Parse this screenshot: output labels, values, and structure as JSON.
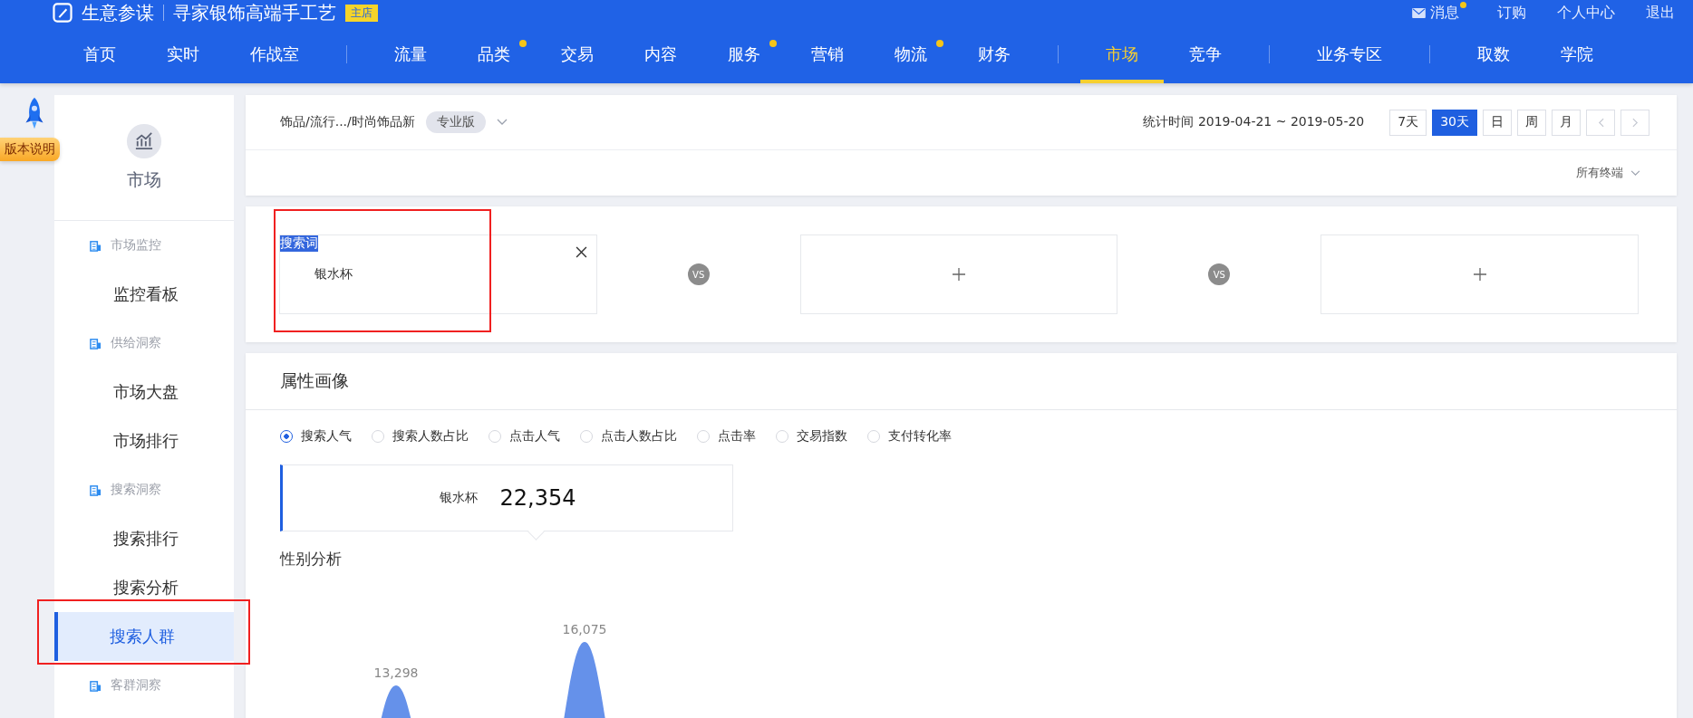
{
  "header": {
    "brand": "生意参谋",
    "shop": "寻家银饰高端手工艺",
    "shop_badge": "主店",
    "top_links": [
      {
        "label": "消息",
        "kind": "mail",
        "dot": true
      },
      {
        "label": "订购",
        "kind": "plain",
        "dot": false
      },
      {
        "label": "个人中心",
        "kind": "plain",
        "dot": false
      },
      {
        "label": "退出",
        "kind": "plain",
        "dot": false
      }
    ],
    "nav_groups": [
      [
        {
          "label": "首页",
          "dot": false,
          "selected": false
        },
        {
          "label": "实时",
          "dot": false,
          "selected": false
        },
        {
          "label": "作战室",
          "dot": false,
          "selected": false
        }
      ],
      [
        {
          "label": "流量",
          "dot": false,
          "selected": false
        },
        {
          "label": "品类",
          "dot": true,
          "selected": false
        },
        {
          "label": "交易",
          "dot": false,
          "selected": false
        },
        {
          "label": "内容",
          "dot": false,
          "selected": false
        },
        {
          "label": "服务",
          "dot": true,
          "selected": false
        },
        {
          "label": "营销",
          "dot": false,
          "selected": false
        },
        {
          "label": "物流",
          "dot": true,
          "selected": false
        },
        {
          "label": "财务",
          "dot": false,
          "selected": false
        }
      ],
      [
        {
          "label": "市场",
          "dot": false,
          "selected": true
        },
        {
          "label": "竞争",
          "dot": false,
          "selected": false
        }
      ],
      [
        {
          "label": "业务专区",
          "dot": false,
          "selected": false
        }
      ],
      [
        {
          "label": "取数",
          "dot": false,
          "selected": false
        },
        {
          "label": "学院",
          "dot": false,
          "selected": false
        }
      ]
    ]
  },
  "version_badge": "版本说明",
  "sidebar": {
    "title": "市场",
    "groups": [
      {
        "label": "市场监控",
        "children": [
          {
            "label": "监控看板",
            "selected": false
          }
        ]
      },
      {
        "label": "供给洞察",
        "children": [
          {
            "label": "市场大盘",
            "selected": false
          },
          {
            "label": "市场排行",
            "selected": false
          }
        ]
      },
      {
        "label": "搜索洞察",
        "children": [
          {
            "label": "搜索排行",
            "selected": false
          },
          {
            "label": "搜索分析",
            "selected": false
          },
          {
            "label": "搜索人群",
            "selected": true
          }
        ]
      },
      {
        "label": "客群洞察"
      }
    ]
  },
  "filter_bar": {
    "breadcrumb": "饰品/流行.../时尚饰品新",
    "edition": "专业版",
    "date_range": "统计时间 2019-04-21 ~ 2019-05-20",
    "periods": [
      {
        "label": "7天",
        "selected": false
      },
      {
        "label": "30天",
        "selected": true
      },
      {
        "label": "日",
        "selected": false
      },
      {
        "label": "周",
        "selected": false
      },
      {
        "label": "月",
        "selected": false
      }
    ],
    "terminal": "所有终端"
  },
  "compare": {
    "cards": [
      {
        "kind": "filled",
        "label": "搜索词",
        "value": "银水杯"
      },
      {
        "kind": "empty",
        "vs": "VS"
      },
      {
        "kind": "empty",
        "vs": "VS"
      }
    ]
  },
  "profile": {
    "title": "属性画像",
    "metrics": [
      {
        "label": "搜索人气",
        "selected": true
      },
      {
        "label": "搜索人数占比",
        "selected": false
      },
      {
        "label": "点击人气",
        "selected": false
      },
      {
        "label": "点击人数占比",
        "selected": false
      },
      {
        "label": "点击率",
        "selected": false
      },
      {
        "label": "交易指数",
        "selected": false
      },
      {
        "label": "支付转化率",
        "selected": false
      }
    ],
    "summary": {
      "term": "银水杯",
      "value": "22,354"
    },
    "gender_title": "性别分析",
    "peak_labels": [
      "13,298",
      "16,075"
    ]
  }
}
